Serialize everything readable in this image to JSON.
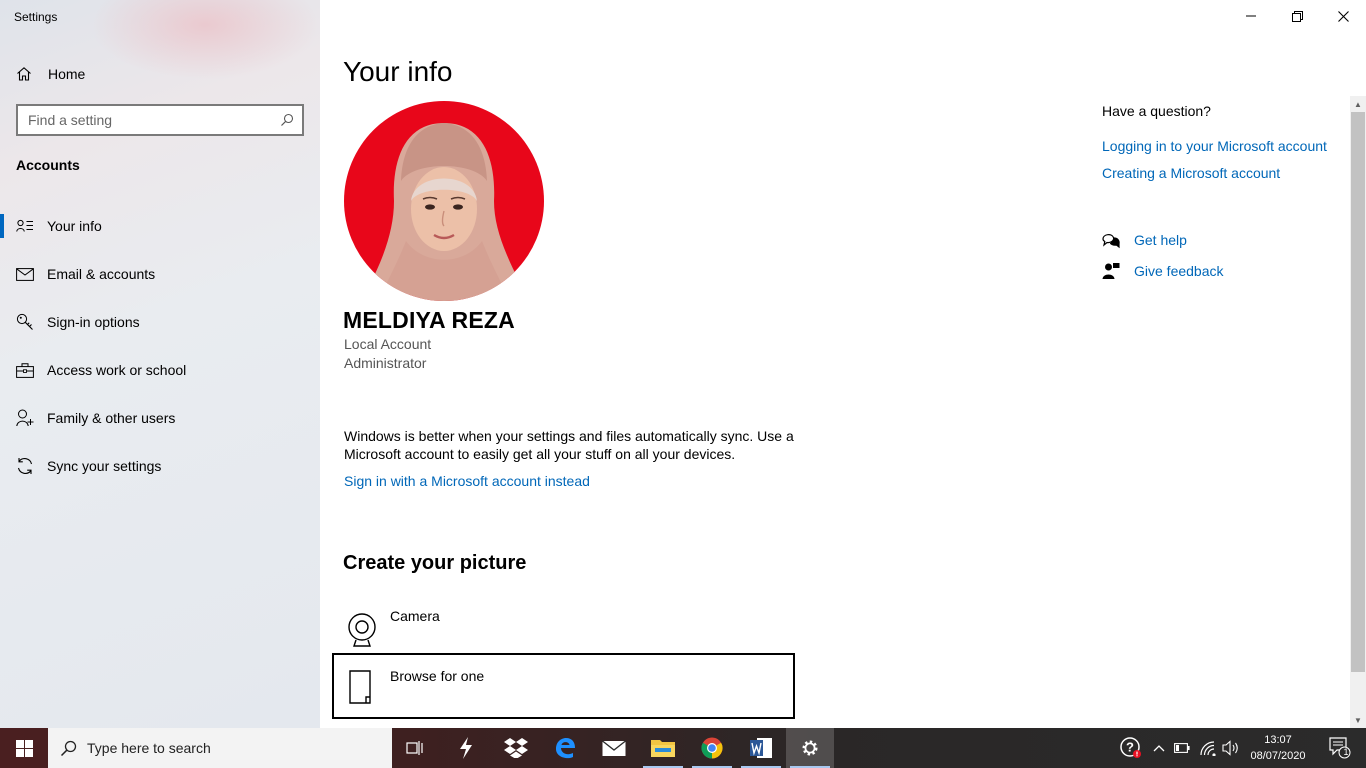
{
  "window": {
    "title": "Settings",
    "controls": {
      "minimize": "minimize-icon",
      "restore": "restore-icon",
      "close": "close-icon"
    }
  },
  "sidebar": {
    "home_label": "Home",
    "search_placeholder": "Find a setting",
    "section_label": "Accounts",
    "items": [
      {
        "label": "Your info",
        "icon": "person-card-icon",
        "active": true
      },
      {
        "label": "Email & accounts",
        "icon": "mail-icon"
      },
      {
        "label": "Sign-in options",
        "icon": "key-icon"
      },
      {
        "label": "Access work or school",
        "icon": "briefcase-icon"
      },
      {
        "label": "Family & other users",
        "icon": "person-add-icon"
      },
      {
        "label": "Sync your settings",
        "icon": "sync-icon"
      }
    ]
  },
  "main": {
    "title": "Your info",
    "user": {
      "name": "MELDIYA REZA",
      "account_type": "Local Account",
      "role": "Administrator"
    },
    "sync_message": "Windows is better when your settings and files automatically sync. Use a Microsoft account to easily get all your stuff on all your devices.",
    "signin_link": "Sign in with a Microsoft account instead",
    "create_picture": {
      "title": "Create your picture",
      "options": [
        {
          "label": "Camera",
          "icon": "camera-icon"
        },
        {
          "label": "Browse for one",
          "icon": "file-icon"
        }
      ]
    }
  },
  "help_panel": {
    "heading": "Have a question?",
    "links": [
      "Logging in to your Microsoft account",
      "Creating a Microsoft account"
    ],
    "get_help": "Get help",
    "give_feedback": "Give feedback"
  },
  "taskbar": {
    "search_placeholder": "Type here to search",
    "apps": [
      "task-view-icon",
      "lightning-app-icon",
      "dropbox-icon",
      "edge-icon",
      "mail-icon",
      "file-explorer-icon",
      "chrome-icon",
      "word-icon",
      "settings-gear-icon"
    ],
    "clock": {
      "time": "13:07",
      "date": "08/07/2020"
    },
    "notification_count": "1"
  },
  "colors": {
    "accent": "#0067c0",
    "link": "#0067b8",
    "avatar_background": "#e8061a"
  }
}
